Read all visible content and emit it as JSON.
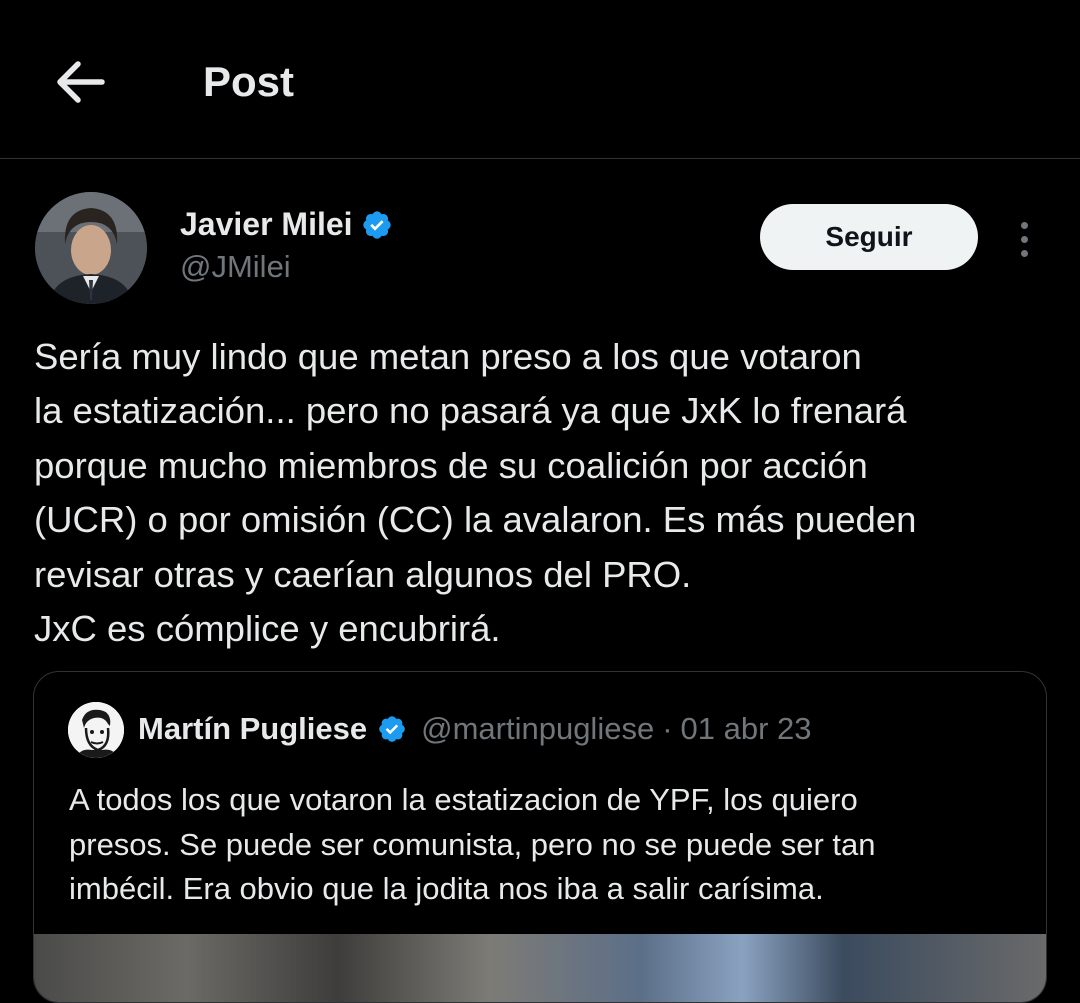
{
  "header": {
    "title": "Post"
  },
  "post": {
    "author": {
      "name": "Javier Milei",
      "handle": "@JMilei"
    },
    "follow_label": "Seguir",
    "text_lines": [
      "Sería muy lindo que metan preso a los que votaron",
      "la estatización... pero no pasará ya que JxK lo frenará",
      "porque mucho miembros de su coalición por acción",
      "(UCR) o por omisión (CC) la avalaron. Es más pueden",
      "revisar otras y caerían algunos del PRO.",
      "JxC es cómplice y encubrirá."
    ]
  },
  "quote": {
    "author": {
      "name": "Martín Pugliese",
      "handle": "@martinpugliese"
    },
    "date": "01 abr 23",
    "separator": "·",
    "text_lines": [
      "A todos los que votaron la estatizacion de YPF, los quiero",
      "presos. Se puede ser comunista, pero no se puede ser tan",
      "imbécil. Era obvio que la jodita nos iba a salir carísima."
    ]
  },
  "icons": {
    "back": "arrow-left-icon",
    "verified": "verified-badge-icon",
    "more": "more-vertical-icon"
  },
  "colors": {
    "background": "#000000",
    "text": "#e7e9ea",
    "secondary_text": "#71767b",
    "verified_blue": "#1d9bf0",
    "follow_button_bg": "#eff3f4"
  }
}
